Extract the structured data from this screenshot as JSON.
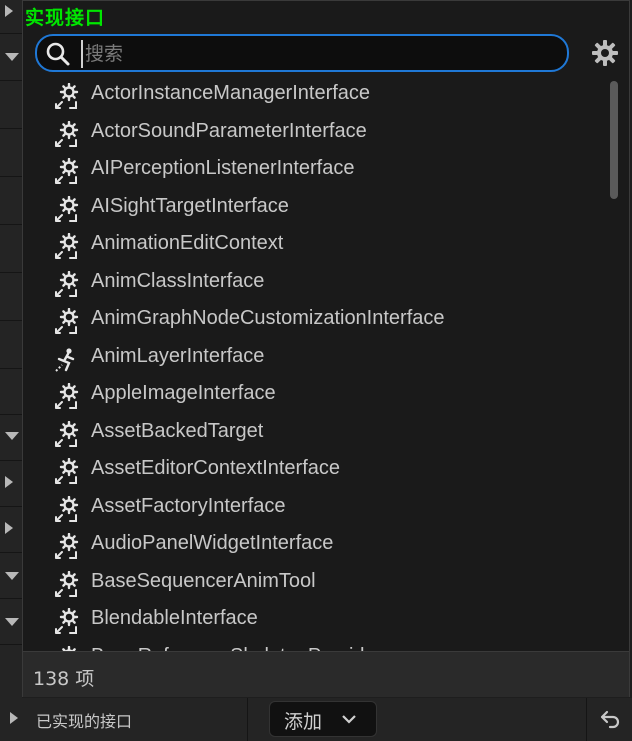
{
  "popup": {
    "title": "实现接口",
    "search_placeholder": "搜索",
    "search_value": "",
    "items": [
      {
        "label": "ActorInstanceManagerInterface",
        "icon": "interface-icon"
      },
      {
        "label": "ActorSoundParameterInterface",
        "icon": "interface-icon"
      },
      {
        "label": "AIPerceptionListenerInterface",
        "icon": "interface-icon"
      },
      {
        "label": "AISightTargetInterface",
        "icon": "interface-icon"
      },
      {
        "label": "AnimationEditContext",
        "icon": "interface-icon"
      },
      {
        "label": "AnimClassInterface",
        "icon": "interface-icon"
      },
      {
        "label": "AnimGraphNodeCustomizationInterface",
        "icon": "interface-icon"
      },
      {
        "label": "AnimLayerInterface",
        "icon": "anim-layer-icon"
      },
      {
        "label": "AppleImageInterface",
        "icon": "interface-icon"
      },
      {
        "label": "AssetBackedTarget",
        "icon": "interface-icon"
      },
      {
        "label": "AssetEditorContextInterface",
        "icon": "interface-icon"
      },
      {
        "label": "AssetFactoryInterface",
        "icon": "interface-icon"
      },
      {
        "label": "AudioPanelWidgetInterface",
        "icon": "interface-icon"
      },
      {
        "label": "BaseSequencerAnimTool",
        "icon": "interface-icon"
      },
      {
        "label": "BlendableInterface",
        "icon": "interface-icon"
      },
      {
        "label": "BoneReferenceSkeletonProvider",
        "icon": "interface-icon"
      }
    ],
    "count_label": "138 项"
  },
  "bottom": {
    "section_label": "已实现的接口",
    "add_label": "添加"
  },
  "colors": {
    "title_green": "#00e600",
    "search_border": "#1f78d6"
  }
}
